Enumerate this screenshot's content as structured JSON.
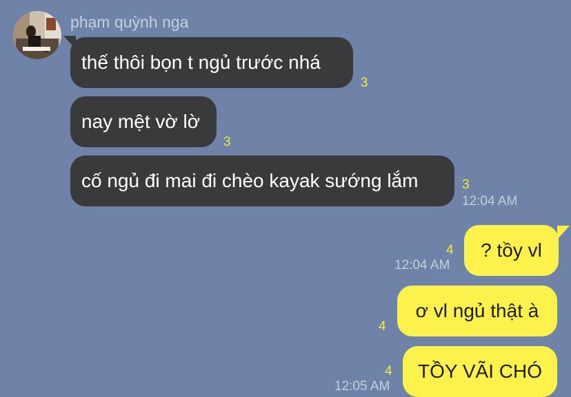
{
  "chat": {
    "sender": {
      "name": "phạm quỳnh nga",
      "avatar_icon": "profile-photo"
    },
    "incoming": [
      {
        "text": "thế thôi bọn t ngủ trước nhá",
        "read_count": "3",
        "time": ""
      },
      {
        "text": "nay mệt vờ lờ",
        "read_count": "3",
        "time": ""
      },
      {
        "text": "cố ngủ đi mai đi chèo kayak sướng lắm",
        "read_count": "3",
        "time": "12:04 AM"
      }
    ],
    "outgoing": [
      {
        "text": "? tồy vl",
        "read_count": "4",
        "time": "12:04 AM"
      },
      {
        "text": "ơ vl ngủ thật à",
        "read_count": "4",
        "time": ""
      },
      {
        "text": "TỒY VÃI CHÓ",
        "read_count": "4",
        "time": "12:05 AM"
      }
    ]
  },
  "colors": {
    "background": "#6f83a9",
    "incoming_bubble": "#3a3a3c",
    "outgoing_bubble": "#fdf14b",
    "read_count": "#f3ea3c",
    "timestamp": "#c6cedc"
  }
}
